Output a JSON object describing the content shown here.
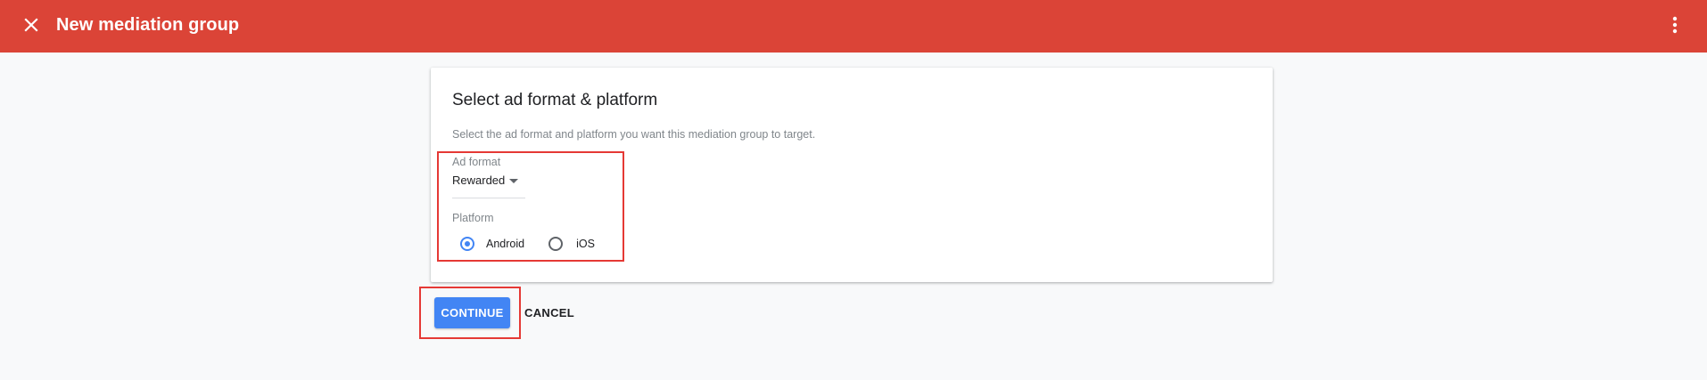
{
  "header": {
    "title": "New mediation group",
    "close_icon": "close-icon",
    "more_icon": "more-vert-icon",
    "background_color": "#db4437"
  },
  "card": {
    "title": "Select ad format & platform",
    "description": "Select the ad format and platform you want this mediation group to target.",
    "ad_format": {
      "label": "Ad format",
      "selected_value": "Rewarded",
      "arrow_icon": "dropdown-arrow-icon"
    },
    "platform": {
      "label": "Platform",
      "options": [
        {
          "label": "Android",
          "checked": true
        },
        {
          "label": "iOS",
          "checked": false
        }
      ]
    }
  },
  "actions": {
    "continue_label": "CONTINUE",
    "cancel_label": "CANCEL",
    "accent_color": "#4285f4"
  },
  "highlight_color": "#e53935"
}
